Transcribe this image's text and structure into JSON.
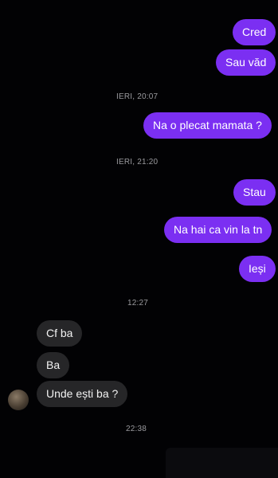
{
  "conversation": {
    "messages": [
      {
        "type": "out",
        "text": "Cred"
      },
      {
        "type": "out",
        "text": "Sau văd"
      },
      {
        "type": "stamp",
        "text": "IERI, 20:07"
      },
      {
        "type": "out",
        "text": "Na o plecat mamata ?"
      },
      {
        "type": "stamp",
        "text": "IERI, 21:20"
      },
      {
        "type": "out",
        "text": "Stau"
      },
      {
        "type": "out",
        "text": "Na hai ca vin la tn"
      },
      {
        "type": "out",
        "text": "Ieși"
      },
      {
        "type": "stamp",
        "text": "12:27"
      },
      {
        "type": "in",
        "text": "Cf ba"
      },
      {
        "type": "in",
        "text": "Ba"
      },
      {
        "type": "in",
        "text": "Unde ești ba ?"
      },
      {
        "type": "stamp",
        "text": "22:38"
      }
    ]
  },
  "colors": {
    "outgoing_bubble": "#7b2ff2",
    "incoming_bubble": "#262628",
    "background": "#020204"
  }
}
